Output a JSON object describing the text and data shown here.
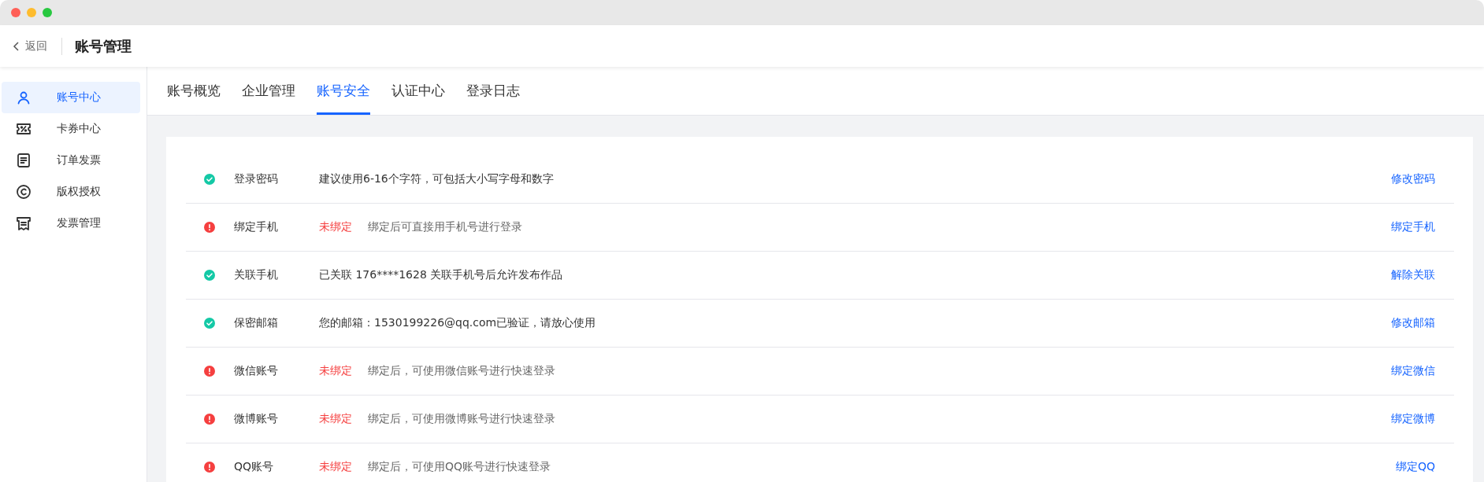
{
  "header": {
    "back_label": "返回",
    "title": "账号管理"
  },
  "sidebar": {
    "items": [
      {
        "label": "账号中心",
        "kind": "user",
        "selected": true
      },
      {
        "label": "卡券中心",
        "kind": "coupon",
        "selected": false
      },
      {
        "label": "订单发票",
        "kind": "doc",
        "selected": false
      },
      {
        "label": "版权授权",
        "kind": "copyright",
        "selected": false
      },
      {
        "label": "发票管理",
        "kind": "invoice",
        "selected": false
      }
    ]
  },
  "tabs": [
    {
      "label": "账号概览",
      "selected": false
    },
    {
      "label": "企业管理",
      "selected": false
    },
    {
      "label": "账号安全",
      "selected": true
    },
    {
      "label": "认证中心",
      "selected": false
    },
    {
      "label": "登录日志",
      "selected": false
    }
  ],
  "security_items": [
    {
      "kind": "ok",
      "label": "登录密码",
      "description": "建议使用6-16个字符，可包括大小写字母和数字",
      "action": "修改密码"
    },
    {
      "kind": "warning",
      "label": "绑定手机",
      "status": "未绑定",
      "description": "绑定后可直接用手机号进行登录",
      "action": "绑定手机"
    },
    {
      "kind": "ok",
      "label": "关联手机",
      "description": "已关联 176****1628 关联手机号后允许发布作品",
      "action": "解除关联"
    },
    {
      "kind": "ok",
      "label": "保密邮箱",
      "description": "您的邮箱：1530199226@qq.com已验证，请放心使用",
      "action": "修改邮箱"
    },
    {
      "kind": "warning",
      "label": "微信账号",
      "status": "未绑定",
      "description": "绑定后，可使用微信账号进行快速登录",
      "action": "绑定微信"
    },
    {
      "kind": "warning",
      "label": "微博账号",
      "status": "未绑定",
      "description": "绑定后，可使用微博账号进行快速登录",
      "action": "绑定微博"
    },
    {
      "kind": "warning",
      "label": "QQ账号",
      "status": "未绑定",
      "description": "绑定后，可使用QQ账号进行快速登录",
      "action": "绑定QQ"
    }
  ]
}
